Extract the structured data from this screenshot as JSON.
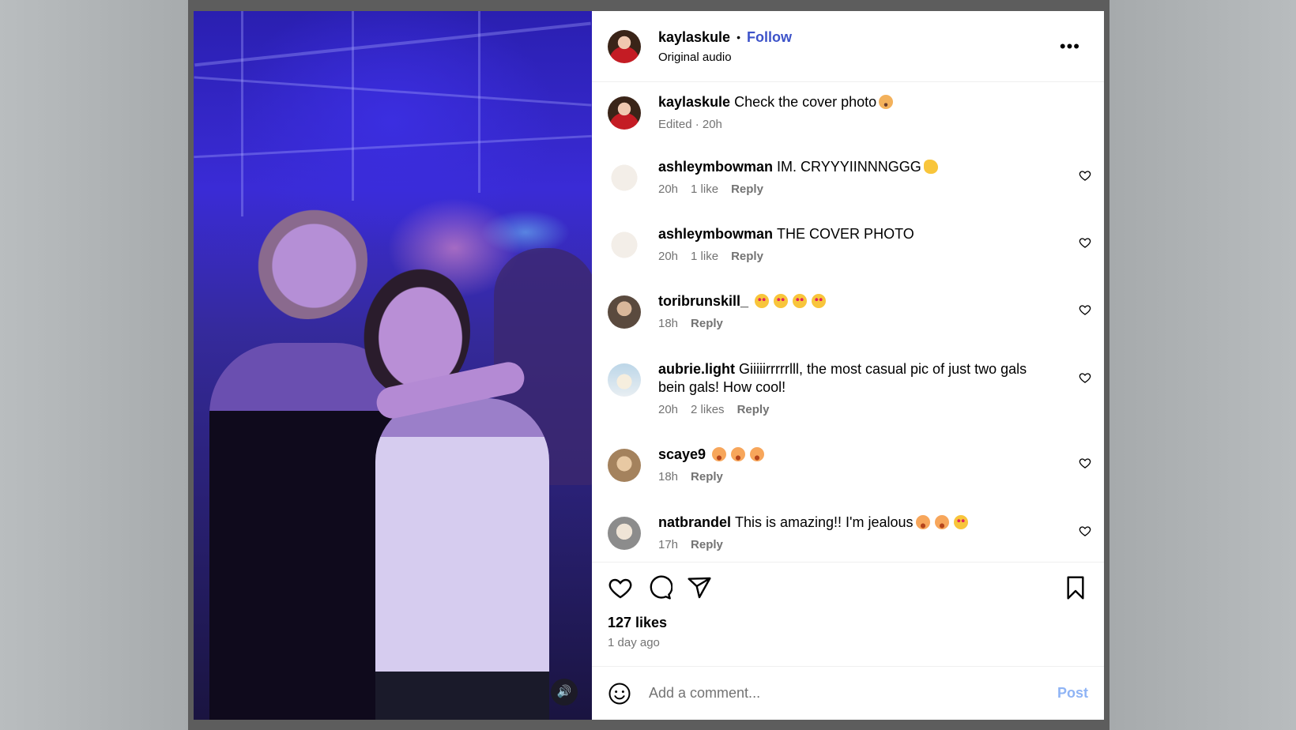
{
  "post": {
    "username": "kaylaskule",
    "follow_label": "Follow",
    "audio": "Original audio",
    "more_icon": "more-horizontal-icon",
    "caption": {
      "username": "kaylaskule",
      "text": "Check the cover photo",
      "meta": "Edited · 20h"
    },
    "likes": "127 likes",
    "time_ago": "1 day ago"
  },
  "comments": [
    {
      "username": "ashleymbowman",
      "text": "IM. CRYYYIINNNGGG",
      "time": "20h",
      "likes": "1 like",
      "reply": "Reply"
    },
    {
      "username": "ashleymbowman",
      "text": "THE COVER PHOTO",
      "time": "20h",
      "likes": "1 like",
      "reply": "Reply"
    },
    {
      "username": "toribrunskill_",
      "text": "",
      "time": "18h",
      "likes": "",
      "reply": "Reply"
    },
    {
      "username": "aubrie.light",
      "text": "Giiiiirrrrrlll, the most casual pic of just two gals bein gals! How cool!",
      "time": "20h",
      "likes": "2 likes",
      "reply": "Reply"
    },
    {
      "username": "scaye9",
      "text": "",
      "time": "18h",
      "likes": "",
      "reply": "Reply"
    },
    {
      "username": "natbrandel",
      "text": "This is amazing!! I'm jealous",
      "time": "17h",
      "likes": "",
      "reply": "Reply"
    }
  ],
  "add_comment": {
    "placeholder": "Add a comment...",
    "post_label": "Post",
    "emoji_icon": "smiley-icon"
  },
  "colors": {
    "follow": "#3d53c9",
    "post_button": "#8fb4f5",
    "meta_text": "#737373",
    "story_ring": "#d62976"
  }
}
